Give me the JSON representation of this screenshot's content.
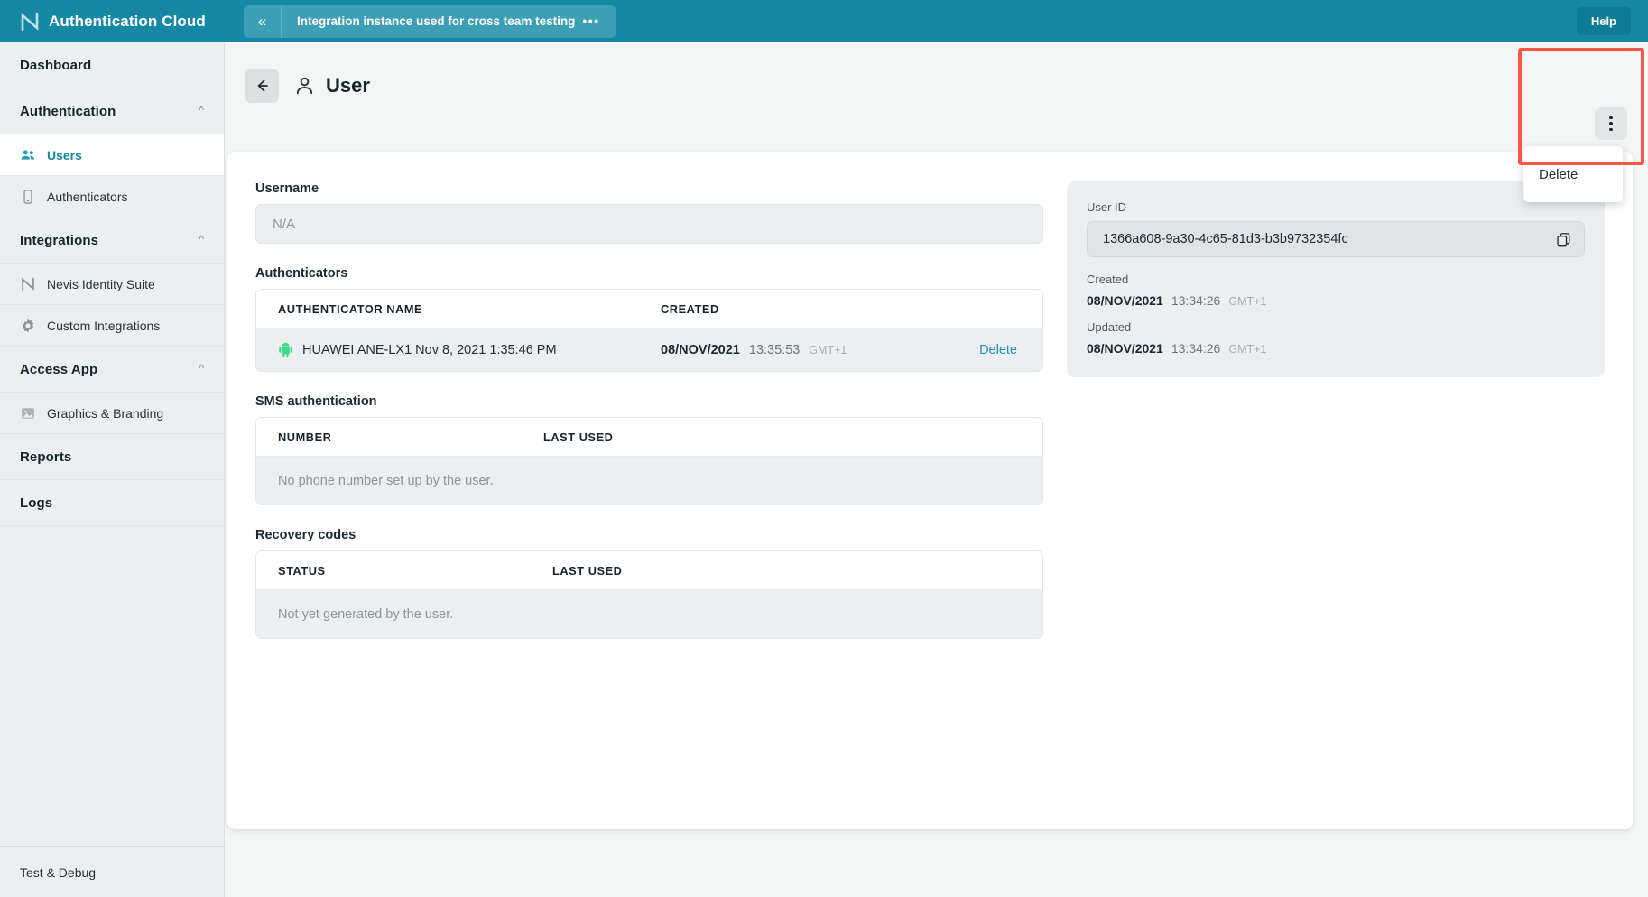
{
  "topbar": {
    "brand": "Authentication Cloud",
    "logo_icon": "nevis-logo-icon",
    "collapse_icon": "double-chevron-left-icon",
    "instance_name": "Integration instance used for cross team testing",
    "instance_overflow": "•••",
    "help_label": "Help"
  },
  "sidebar": {
    "items": [
      {
        "label": "Dashboard",
        "type": "section",
        "icon": null,
        "expanded": null
      },
      {
        "label": "Authentication",
        "type": "section",
        "icon": "chevron-up-icon",
        "expanded": true
      },
      {
        "label": "Users",
        "type": "item",
        "icon": "people-icon",
        "active": true
      },
      {
        "label": "Authenticators",
        "type": "item",
        "icon": "mobile-device-icon",
        "active": false
      },
      {
        "label": "Integrations",
        "type": "section",
        "icon": "chevron-up-icon",
        "expanded": true
      },
      {
        "label": "Nevis Identity Suite",
        "type": "item",
        "icon": "nevis-logo-icon",
        "active": false
      },
      {
        "label": "Custom Integrations",
        "type": "item",
        "icon": "gear-icon",
        "active": false
      },
      {
        "label": "Access App",
        "type": "section",
        "icon": "chevron-up-icon",
        "expanded": true
      },
      {
        "label": "Graphics & Branding",
        "type": "item",
        "icon": "image-icon",
        "active": false
      },
      {
        "label": "Reports",
        "type": "section",
        "icon": null,
        "expanded": null
      },
      {
        "label": "Logs",
        "type": "section",
        "icon": null,
        "expanded": null
      }
    ],
    "footer": {
      "label": "Test & Debug"
    }
  },
  "page": {
    "back_icon": "arrow-left-icon",
    "title_icon": "person-icon",
    "title": "User",
    "kebab_icon": "kebab-menu-icon",
    "menu": {
      "delete_label": "Delete"
    },
    "highlight_color": "#f9564a"
  },
  "username": {
    "label": "Username",
    "value": "",
    "placeholder": "N/A"
  },
  "authenticators": {
    "label": "Authenticators",
    "columns": [
      "AUTHENTICATOR NAME",
      "CREATED"
    ],
    "rows": [
      {
        "icon": "android-icon",
        "name": "HUAWEI ANE-LX1 Nov 8, 2021 1:35:46 PM",
        "created_date": "08/NOV/2021",
        "created_time": "13:35:53",
        "created_tz": "GMT+1",
        "action": "Delete"
      }
    ]
  },
  "sms": {
    "label": "SMS authentication",
    "columns": [
      "NUMBER",
      "LAST USED"
    ],
    "empty_text": "No phone number set up by the user."
  },
  "recovery": {
    "label": "Recovery codes",
    "columns": [
      "STATUS",
      "LAST USED"
    ],
    "empty_text": "Not yet generated by the user."
  },
  "info": {
    "user_id_label": "User ID",
    "user_id": "1366a608-9a30-4c65-81d3-b3b9732354fc",
    "copy_icon": "copy-icon",
    "created_label": "Created",
    "created_date": "08/NOV/2021",
    "created_time": "13:34:26",
    "created_tz": "GMT+1",
    "updated_label": "Updated",
    "updated_date": "08/NOV/2021",
    "updated_time": "13:34:26",
    "updated_tz": "GMT+1"
  },
  "colors": {
    "brand_teal": "#1488a5",
    "link_blue": "#1d8fb0",
    "sidebar_bg": "#eceff0",
    "page_bg": "#f4f6f6",
    "highlight_red": "#f9564a"
  }
}
